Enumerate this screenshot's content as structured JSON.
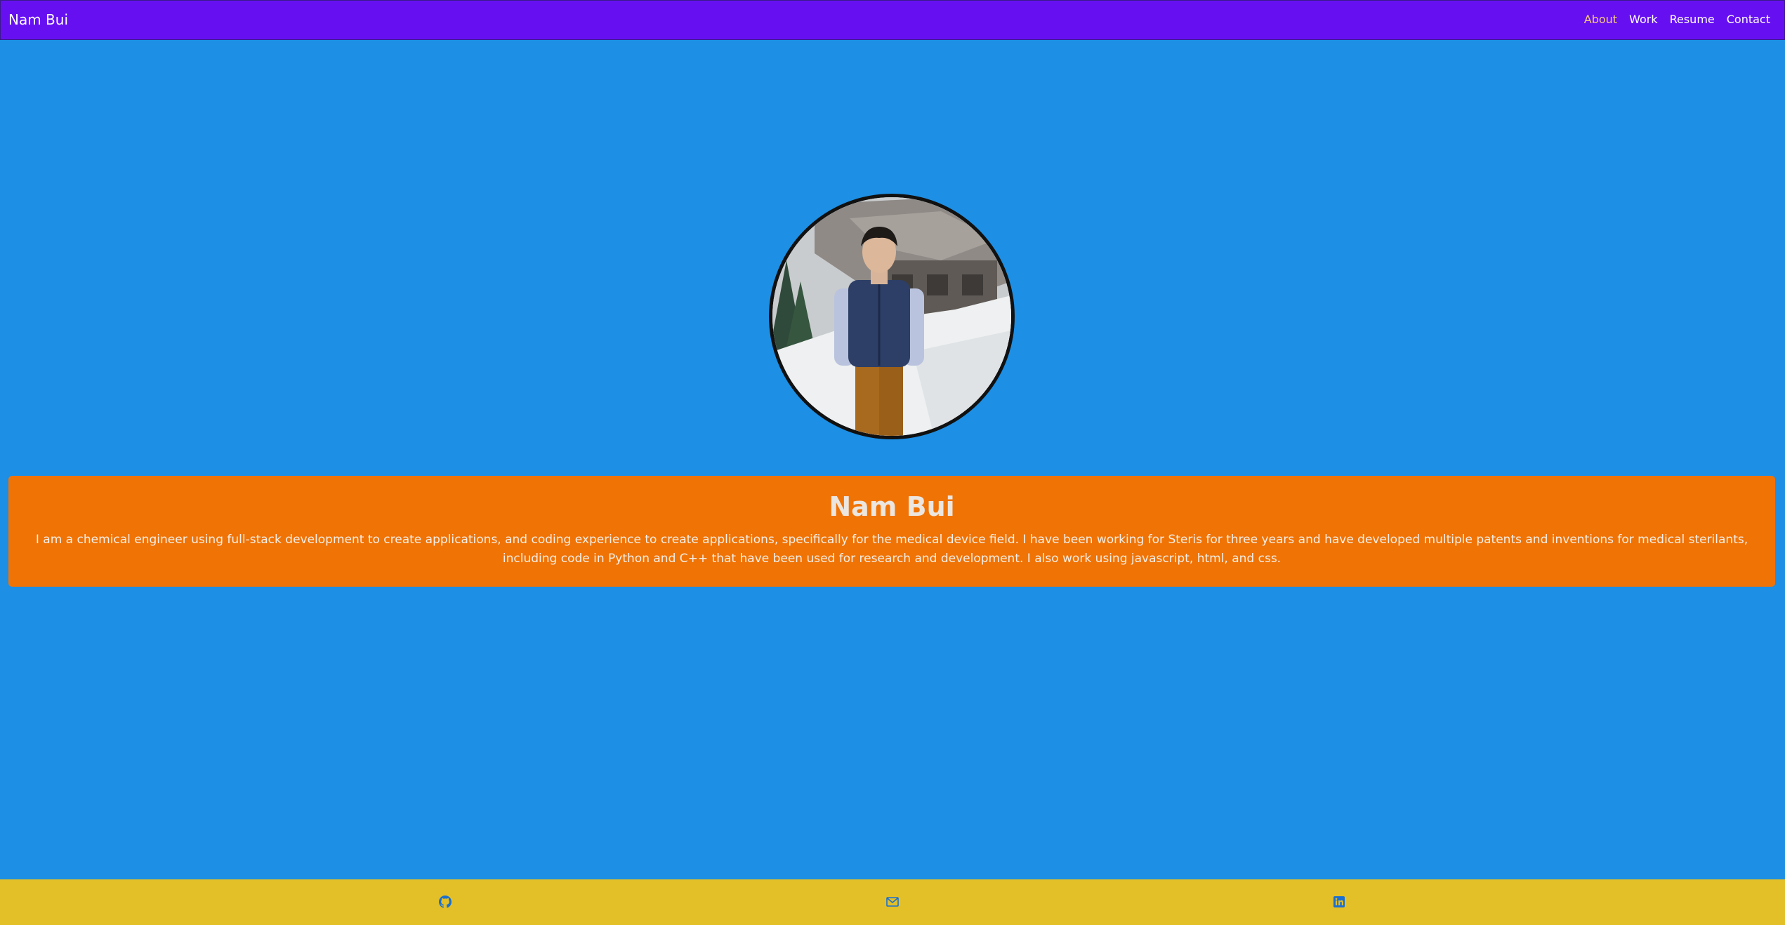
{
  "navbar": {
    "brand": "Nam Bui",
    "links": [
      "About",
      "Work",
      "Resume",
      "Contact"
    ]
  },
  "profile": {
    "name": "Nam Bui",
    "bio": "I am a chemical engineer using full-stack development to create applications, and coding experience to create applications, specifically for the medical device field. I have been working for Steris for three years and have developed multiple patents and inventions for medical sterilants, including code in Python and C++ that have been used for research and development. I also work using javascript, html, and css."
  },
  "footer": {
    "icons": [
      "github-icon",
      "email-icon",
      "linkedin-icon"
    ]
  },
  "colors": {
    "page_background": "#1d8fe4",
    "navbar": "#6610f2",
    "active_link": "#f7c97d",
    "card": "#f07306",
    "footer": "#e3c028",
    "footer_icons": "#1a6fd0"
  }
}
